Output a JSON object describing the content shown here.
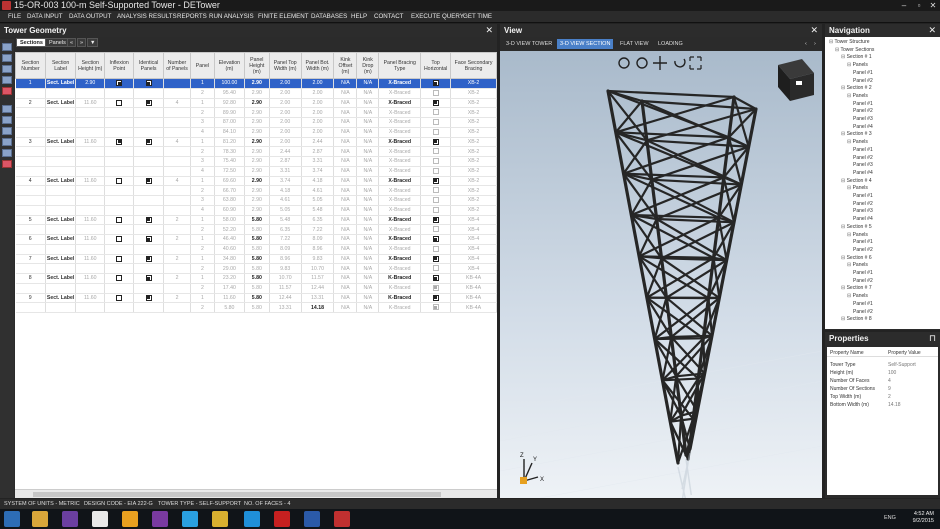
{
  "app": {
    "title": "15-OR-003 100-m Self-Supported Tower - DETower",
    "controls": [
      "–",
      "▫",
      "✕"
    ]
  },
  "menu": [
    "FILE",
    "DATA INPUT",
    "DATA OUTPUT",
    "ANALYSIS RESULTS",
    "REPORTS",
    "RUN ANALYSIS",
    "FINITE ELEMENT",
    "DATABASES",
    "HELP",
    "CONTACT",
    "EXECUTE QUERY",
    "GET TIME"
  ],
  "geometry": {
    "title": "Tower Geometry",
    "close": "✕",
    "tabs": [
      "Sections",
      "Panels"
    ],
    "tab_icons": [
      "«",
      "»",
      "▼"
    ],
    "columns": [
      "Section Number",
      "Section Label",
      "Section Height (m)",
      "Inflexion Point",
      "Identical Panels",
      "Number of Panels",
      "Panel",
      "Elevation (m)",
      "Panel Height (m)",
      "Panel Top Width (m)",
      "Panel Bot. Width (m)",
      "Kink Offset (m)",
      "Kink Drop (m)",
      "Panel Bracing Type",
      "Top Horizontal",
      "Face Secondary Bracing"
    ],
    "rows": [
      {
        "sec": "1",
        "label": "Sect. Label",
        "sh": "2.90",
        "inf": true,
        "idp": true,
        "np": "",
        "panel": "1",
        "elev": "100.00",
        "ph": "2.90",
        "ptw": "2.00",
        "pbw": "2.00",
        "ko": "N/A",
        "kd": "N/A",
        "bt": "X-Braced",
        "th": true,
        "fsb": "XB-2",
        "selected": true
      },
      {
        "sec": "",
        "label": "",
        "sh": "",
        "inf": null,
        "idp": null,
        "np": "",
        "panel": "2",
        "elev": "95.40",
        "ph": "2.90",
        "ptw": "2.00",
        "pbw": "2.00",
        "ko": "N/A",
        "kd": "N/A",
        "bt": "X-Braced",
        "th": false,
        "fsb": "XB-2"
      },
      {
        "sec": "2",
        "label": "Sect. Label",
        "sh": "11.60",
        "inf": false,
        "idp": true,
        "np": "4",
        "panel": "1",
        "elev": "92.80",
        "ph": "2.90",
        "ptw": "2.00",
        "pbw": "2.00",
        "ko": "N/A",
        "kd": "N/A",
        "bt": "X-Braced",
        "th": true,
        "fsb": "XB-2"
      },
      {
        "sec": "",
        "label": "",
        "sh": "",
        "inf": null,
        "idp": null,
        "np": "",
        "panel": "2",
        "elev": "89.90",
        "ph": "2.90",
        "ptw": "2.00",
        "pbw": "2.00",
        "ko": "N/A",
        "kd": "N/A",
        "bt": "X-Braced",
        "th": false,
        "fsb": "XB-2"
      },
      {
        "sec": "",
        "label": "",
        "sh": "",
        "inf": null,
        "idp": null,
        "np": "",
        "panel": "3",
        "elev": "87.00",
        "ph": "2.90",
        "ptw": "2.00",
        "pbw": "2.00",
        "ko": "N/A",
        "kd": "N/A",
        "bt": "X-Braced",
        "th": false,
        "fsb": "XB-2"
      },
      {
        "sec": "",
        "label": "",
        "sh": "",
        "inf": null,
        "idp": null,
        "np": "",
        "panel": "4",
        "elev": "84.10",
        "ph": "2.90",
        "ptw": "2.00",
        "pbw": "2.00",
        "ko": "N/A",
        "kd": "N/A",
        "bt": "X-Braced",
        "th": false,
        "fsb": "XB-2"
      },
      {
        "sec": "3",
        "label": "Sect. Label",
        "sh": "11.60",
        "inf": true,
        "idp": true,
        "np": "4",
        "panel": "1",
        "elev": "81.20",
        "ph": "2.90",
        "ptw": "2.00",
        "pbw": "2.44",
        "ko": "N/A",
        "kd": "N/A",
        "bt": "X-Braced",
        "th": true,
        "fsb": "XB-2"
      },
      {
        "sec": "",
        "label": "",
        "sh": "",
        "inf": null,
        "idp": null,
        "np": "",
        "panel": "2",
        "elev": "78.30",
        "ph": "2.90",
        "ptw": "2.44",
        "pbw": "2.87",
        "ko": "N/A",
        "kd": "N/A",
        "bt": "X-Braced",
        "th": false,
        "fsb": "XB-2"
      },
      {
        "sec": "",
        "label": "",
        "sh": "",
        "inf": null,
        "idp": null,
        "np": "",
        "panel": "3",
        "elev": "75.40",
        "ph": "2.90",
        "ptw": "2.87",
        "pbw": "3.31",
        "ko": "N/A",
        "kd": "N/A",
        "bt": "X-Braced",
        "th": false,
        "fsb": "XB-2"
      },
      {
        "sec": "",
        "label": "",
        "sh": "",
        "inf": null,
        "idp": null,
        "np": "",
        "panel": "4",
        "elev": "72.50",
        "ph": "2.90",
        "ptw": "3.31",
        "pbw": "3.74",
        "ko": "N/A",
        "kd": "N/A",
        "bt": "X-Braced",
        "th": false,
        "fsb": "XB-2"
      },
      {
        "sec": "4",
        "label": "Sect. Label",
        "sh": "11.60",
        "inf": false,
        "idp": true,
        "np": "4",
        "panel": "1",
        "elev": "69.60",
        "ph": "2.90",
        "ptw": "3.74",
        "pbw": "4.18",
        "ko": "N/A",
        "kd": "N/A",
        "bt": "X-Braced",
        "th": true,
        "fsb": "XB-2"
      },
      {
        "sec": "",
        "label": "",
        "sh": "",
        "inf": null,
        "idp": null,
        "np": "",
        "panel": "2",
        "elev": "66.70",
        "ph": "2.90",
        "ptw": "4.18",
        "pbw": "4.61",
        "ko": "N/A",
        "kd": "N/A",
        "bt": "X-Braced",
        "th": false,
        "fsb": "XB-2"
      },
      {
        "sec": "",
        "label": "",
        "sh": "",
        "inf": null,
        "idp": null,
        "np": "",
        "panel": "3",
        "elev": "63.80",
        "ph": "2.90",
        "ptw": "4.61",
        "pbw": "5.05",
        "ko": "N/A",
        "kd": "N/A",
        "bt": "X-Braced",
        "th": false,
        "fsb": "XB-2"
      },
      {
        "sec": "",
        "label": "",
        "sh": "",
        "inf": null,
        "idp": null,
        "np": "",
        "panel": "4",
        "elev": "60.90",
        "ph": "2.90",
        "ptw": "5.05",
        "pbw": "5.48",
        "ko": "N/A",
        "kd": "N/A",
        "bt": "X-Braced",
        "th": false,
        "fsb": "XB-2"
      },
      {
        "sec": "5",
        "label": "Sect. Label",
        "sh": "11.60",
        "inf": false,
        "idp": true,
        "np": "2",
        "panel": "1",
        "elev": "58.00",
        "ph": "5.80",
        "ptw": "5.48",
        "pbw": "6.35",
        "ko": "N/A",
        "kd": "N/A",
        "bt": "X-Braced",
        "th": true,
        "fsb": "XB-4"
      },
      {
        "sec": "",
        "label": "",
        "sh": "",
        "inf": null,
        "idp": null,
        "np": "",
        "panel": "2",
        "elev": "52.20",
        "ph": "5.80",
        "ptw": "6.35",
        "pbw": "7.22",
        "ko": "N/A",
        "kd": "N/A",
        "bt": "X-Braced",
        "th": false,
        "fsb": "XB-4"
      },
      {
        "sec": "6",
        "label": "Sect. Label",
        "sh": "11.60",
        "inf": false,
        "idp": true,
        "np": "2",
        "panel": "1",
        "elev": "46.40",
        "ph": "5.80",
        "ptw": "7.22",
        "pbw": "8.09",
        "ko": "N/A",
        "kd": "N/A",
        "bt": "X-Braced",
        "th": true,
        "fsb": "XB-4"
      },
      {
        "sec": "",
        "label": "",
        "sh": "",
        "inf": null,
        "idp": null,
        "np": "",
        "panel": "2",
        "elev": "40.60",
        "ph": "5.80",
        "ptw": "8.09",
        "pbw": "8.96",
        "ko": "N/A",
        "kd": "N/A",
        "bt": "X-Braced",
        "th": false,
        "fsb": "XB-4"
      },
      {
        "sec": "7",
        "label": "Sect. Label",
        "sh": "11.60",
        "inf": false,
        "idp": true,
        "np": "2",
        "panel": "1",
        "elev": "34.80",
        "ph": "5.80",
        "ptw": "8.96",
        "pbw": "9.83",
        "ko": "N/A",
        "kd": "N/A",
        "bt": "X-Braced",
        "th": true,
        "fsb": "XB-4"
      },
      {
        "sec": "",
        "label": "",
        "sh": "",
        "inf": null,
        "idp": null,
        "np": "",
        "panel": "2",
        "elev": "29.00",
        "ph": "5.80",
        "ptw": "9.83",
        "pbw": "10.70",
        "ko": "N/A",
        "kd": "N/A",
        "bt": "X-Braced",
        "th": false,
        "fsb": "XB-4"
      },
      {
        "sec": "8",
        "label": "Sect. Label",
        "sh": "11.60",
        "inf": false,
        "idp": true,
        "np": "2",
        "panel": "1",
        "elev": "23.20",
        "ph": "5.80",
        "ptw": "10.70",
        "pbw": "11.57",
        "ko": "N/A",
        "kd": "N/A",
        "bt": "K-Braced",
        "th": true,
        "fsb": "KB-4A"
      },
      {
        "sec": "",
        "label": "",
        "sh": "",
        "inf": null,
        "idp": null,
        "np": "",
        "panel": "2",
        "elev": "17.40",
        "ph": "5.80",
        "ptw": "11.57",
        "pbw": "12.44",
        "ko": "N/A",
        "kd": "N/A",
        "bt": "K-Braced",
        "th": true,
        "fsb": "KB-4A"
      },
      {
        "sec": "9",
        "label": "Sect. Label",
        "sh": "11.60",
        "inf": false,
        "idp": true,
        "np": "2",
        "panel": "1",
        "elev": "11.60",
        "ph": "5.80",
        "ptw": "12.44",
        "pbw": "13.31",
        "ko": "N/A",
        "kd": "N/A",
        "bt": "K-Braced",
        "th": true,
        "fsb": "KB-4A"
      },
      {
        "sec": "",
        "label": "",
        "sh": "",
        "inf": null,
        "idp": null,
        "np": "",
        "panel": "2",
        "elev": "5.80",
        "ph": "5.80",
        "ptw": "13.31",
        "pbw": "14.18",
        "ko": "N/A",
        "kd": "N/A",
        "bt": "K-Braced",
        "th": true,
        "fsb": "KB-4A"
      }
    ]
  },
  "status": [
    "SYSTEM OF UNITS - METRIC",
    "DESIGN CODE - EIA 222-G",
    "TOWER TYPE - SELF-SUPPORT",
    "NO. OF FACES - 4"
  ],
  "view": {
    "title": "View",
    "close": "✕",
    "tabs": [
      "3-D VIEW TOWER",
      "3-D VIEW SECTION",
      "FLAT VIEW",
      "LOADING"
    ],
    "tab_arrows": [
      "‹",
      "›"
    ],
    "tools": [
      "zoom-in-icon",
      "zoom-icon",
      "pan-icon",
      "rotate-icon",
      "fit-icon"
    ],
    "axis": [
      "Z",
      "Y",
      "X"
    ]
  },
  "navigation": {
    "title": "Navigation",
    "close": "✕",
    "tree": [
      {
        "t": "Tower Structure",
        "lvl": 0
      },
      {
        "t": "Tower Sections",
        "lvl": 1
      },
      {
        "t": "Section # 1",
        "lvl": 2
      },
      {
        "t": "Panels",
        "lvl": 3
      },
      {
        "t": "Panel #1",
        "lvl": 4
      },
      {
        "t": "Panel #2",
        "lvl": 4
      },
      {
        "t": "Section # 2",
        "lvl": 2
      },
      {
        "t": "Panels",
        "lvl": 3
      },
      {
        "t": "Panel #1",
        "lvl": 4
      },
      {
        "t": "Panel #2",
        "lvl": 4
      },
      {
        "t": "Panel #3",
        "lvl": 4
      },
      {
        "t": "Panel #4",
        "lvl": 4
      },
      {
        "t": "Section # 3",
        "lvl": 2
      },
      {
        "t": "Panels",
        "lvl": 3
      },
      {
        "t": "Panel #1",
        "lvl": 4
      },
      {
        "t": "Panel #2",
        "lvl": 4
      },
      {
        "t": "Panel #3",
        "lvl": 4
      },
      {
        "t": "Panel #4",
        "lvl": 4
      },
      {
        "t": "Section # 4",
        "lvl": 2
      },
      {
        "t": "Panels",
        "lvl": 3
      },
      {
        "t": "Panel #1",
        "lvl": 4
      },
      {
        "t": "Panel #2",
        "lvl": 4
      },
      {
        "t": "Panel #3",
        "lvl": 4
      },
      {
        "t": "Panel #4",
        "lvl": 4
      },
      {
        "t": "Section # 5",
        "lvl": 2
      },
      {
        "t": "Panels",
        "lvl": 3
      },
      {
        "t": "Panel #1",
        "lvl": 4
      },
      {
        "t": "Panel #2",
        "lvl": 4
      },
      {
        "t": "Section # 6",
        "lvl": 2
      },
      {
        "t": "Panels",
        "lvl": 3
      },
      {
        "t": "Panel #1",
        "lvl": 4
      },
      {
        "t": "Panel #2",
        "lvl": 4
      },
      {
        "t": "Section # 7",
        "lvl": 2
      },
      {
        "t": "Panels",
        "lvl": 3
      },
      {
        "t": "Panel #1",
        "lvl": 4
      },
      {
        "t": "Panel #2",
        "lvl": 4
      },
      {
        "t": "Section # 8",
        "lvl": 2
      }
    ]
  },
  "properties": {
    "title": "Properties",
    "pin": "⊓",
    "header": {
      "name": "Property Name",
      "value": "Property Value"
    },
    "rows": [
      {
        "name": "Tower Type",
        "value": "Self-Support"
      },
      {
        "name": "Height (m)",
        "value": "100"
      },
      {
        "name": "Number Of Faces",
        "value": "4"
      },
      {
        "name": "Number Of Sections",
        "value": "9"
      },
      {
        "name": "Top Width (m)",
        "value": "2"
      },
      {
        "name": "Bottom Width  (m)",
        "value": "14.18"
      }
    ]
  },
  "clock": {
    "time": "4:52 AM",
    "date": "9/2/2015",
    "lang": "ENG"
  },
  "taskbar": [
    "explorer",
    "file-manager",
    "visual-studio",
    "notepad",
    "outlook",
    "app",
    "internet-explorer",
    "app2",
    "skype",
    "acrobat",
    "word",
    "detower"
  ],
  "colors": {
    "accent": "#2f62c8",
    "panel_bg": "#2b2b2b",
    "tab_active": "#4a80c8",
    "canvas_top": "#aebecf",
    "canvas_bottom": "#e9eff5"
  }
}
